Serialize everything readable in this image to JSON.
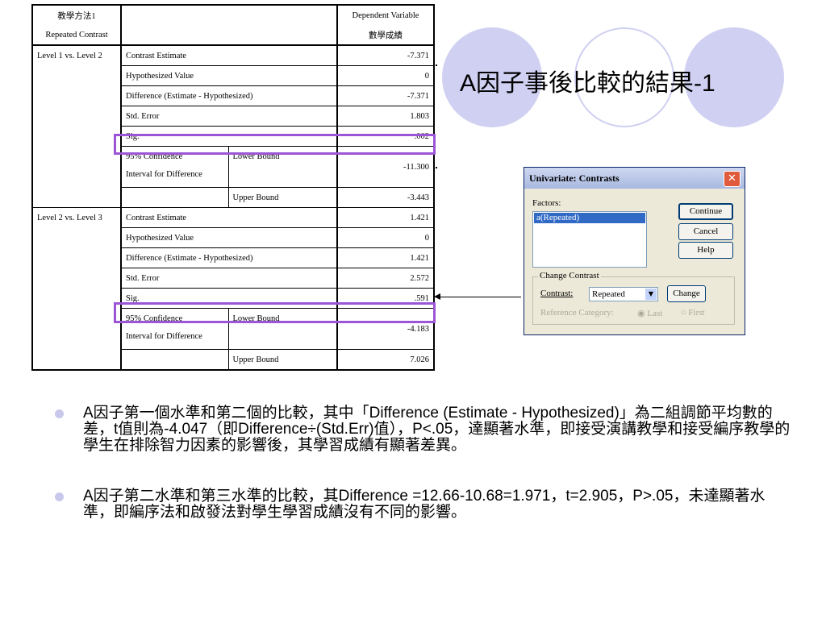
{
  "table": {
    "header": {
      "method_label": "教學方法1",
      "contrast_type": "Repeated Contrast",
      "dv_label": "Dependent Variable",
      "dv_name": "數學成績"
    },
    "sections": [
      {
        "name": "Level 1 vs. Level 2",
        "contrast_estimate_label": "Contrast Estimate",
        "contrast_estimate": "-7.371",
        "hypothesized_label": "Hypothesized Value",
        "hypothesized": "0",
        "difference_label": "Difference (Estimate - Hypothesized)",
        "difference": "-7.371",
        "std_error_label": "Std. Error",
        "std_error": "1.803",
        "sig_label": "Sig.",
        "sig": ".002",
        "ci_label_1": "95% Confidence",
        "ci_label_2": "Interval for Difference",
        "lower_label": "Lower Bound",
        "lower": "-11.300",
        "upper_label": "Upper Bound",
        "upper": "-3.443"
      },
      {
        "name": "Level 2 vs. Level 3",
        "contrast_estimate_label": "Contrast Estimate",
        "contrast_estimate": "1.421",
        "hypothesized_label": "Hypothesized Value",
        "hypothesized": "0",
        "difference_label": "Difference (Estimate - Hypothesized)",
        "difference": "1.421",
        "std_error_label": "Std. Error",
        "std_error": "2.572",
        "sig_label": "Sig.",
        "sig": ".591",
        "ci_label_1": "95% Confidence",
        "ci_label_2": "Interval for Difference",
        "lower_label": "Lower Bound",
        "lower": "-4.183",
        "upper_label": "Upper Bound",
        "upper": "7.026"
      }
    ]
  },
  "slide": {
    "title": "A因子事後比較的結果-1",
    "bullets": [
      "A因子第一個水準和第二個的比較，其中「Difference (Estimate - Hypothesized)」為二組調節平均數的差，t值則為-4.047（即Difference÷(Std.Err)值），P<.05，達顯著水準，即接受演講教學和接受編序教學的學生在排除智力因素的影響後，其學習成績有顯著差異。",
      "A因子第二水準和第三水準的比較，其Difference =12.66-10.68=1.971，t=2.905，P>.05，未達顯著水準，即編序法和啟發法對學生學習成績沒有不同的影響。"
    ]
  },
  "dialog": {
    "title": "Univariate: Contrasts",
    "factors_label": "Factors:",
    "factor_item": "a(Repeated)",
    "continue_label": "Continue",
    "cancel_label": "Cancel",
    "help_label": "Help",
    "change_contrast_label": "Change Contrast",
    "contrast_label": "Contrast:",
    "contrast_value": "Repeated",
    "change_label": "Change",
    "reference_label": "Reference Category:",
    "last_label": "Last",
    "first_label": "First"
  },
  "colors": {
    "highlight": "#9b55d6",
    "circle_fill": "#d0d0f2",
    "dialog_bg": "#ece9d8",
    "close_button": "#e05a3c",
    "selection": "#316ac5"
  },
  "icons": [
    "close-icon",
    "dropdown-arrow-icon",
    "radio-icon",
    "arrow-left-icon",
    "bullet-icon"
  ]
}
